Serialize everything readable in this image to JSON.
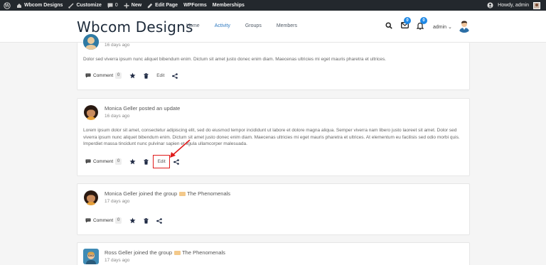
{
  "adminbar": {
    "site_name": "Wbcom Designs",
    "customize": "Customize",
    "comments_count": "0",
    "new": "New",
    "edit_page": "Edit Page",
    "wpforms": "WPForms",
    "memberships": "Memberships",
    "howdy": "Howdy, admin"
  },
  "header": {
    "logo": "Wbcom Designs",
    "nav": [
      "Home",
      "Activity",
      "Groups",
      "Members"
    ],
    "active_nav": "Activity",
    "messages_badge": "0",
    "notifications_badge": "0",
    "user_name": "admin"
  },
  "activities": [
    {
      "time": "16 days ago",
      "content": "Dolor sed viverra ipsum nunc aliquet bibendum enim. Dictum sit amet justo donec enim diam. Maecenas ultricies mi eget mauris pharetra et ultrices.",
      "comment_label": "Comment",
      "comment_count": "0",
      "edit_label": "Edit"
    },
    {
      "title": "Monica Geller posted an update",
      "time": "16 days ago",
      "content": "Lorem ipsum dolor sit amet, consectetur adipiscing elit, sed do eiusmod tempor incididunt ut labore et dolore magna aliqua. Semper viverra nam libero justo laoreet sit amet. Dolor sed viverra ipsum nunc aliquet bibendum enim. Dictum sit amet justo donec enim diam. Maecenas ultricies mi eget mauris pharetra et ultrices. At elementum eu facilisis sed odio morbi quis. Imperdiet massa tincidunt nunc pulvinar sapien et ligula ullamcorper malesuada.",
      "comment_label": "Comment",
      "comment_count": "0",
      "edit_label": "Edit"
    },
    {
      "title_prefix": "Monica Geller joined the group",
      "group_name": "The Phenomenals",
      "time": "17 days ago",
      "comment_label": "Comment",
      "comment_count": "0"
    },
    {
      "title_prefix": "Ross Geller joined the group",
      "group_name": "The Phenomenals",
      "time": "17 days ago"
    }
  ],
  "colors": {
    "accent": "#2f7ac0",
    "admin_bar": "#23282d",
    "badge": "#1e88e5",
    "highlight": "#e01b1b"
  }
}
